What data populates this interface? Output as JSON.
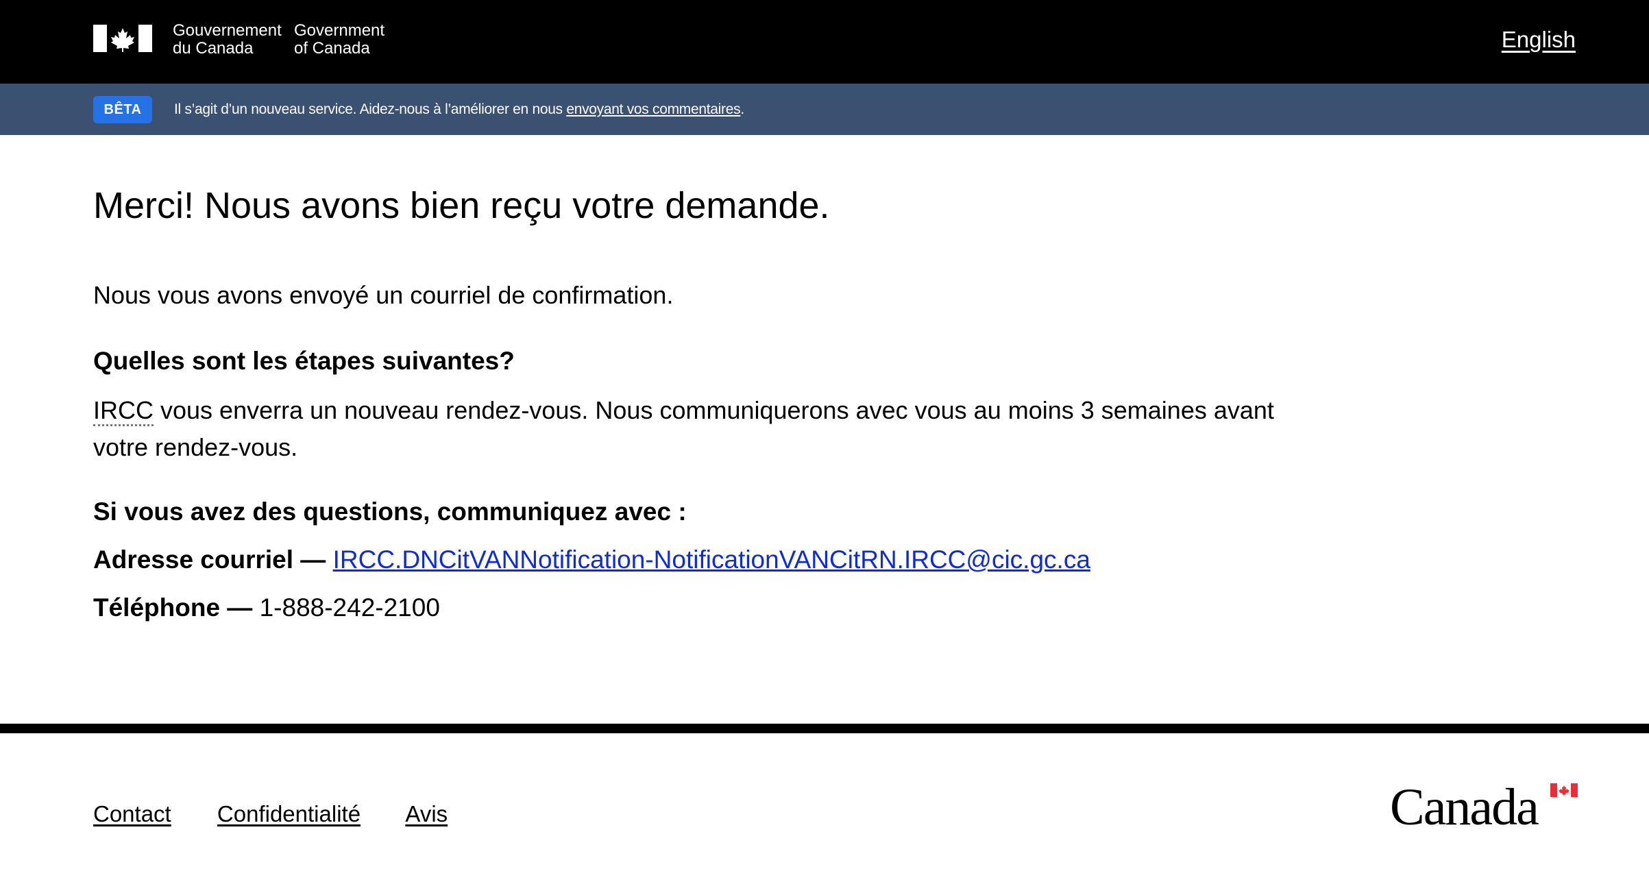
{
  "header": {
    "signature_fr_line1": "Gouvernement",
    "signature_fr_line2": "du Canada",
    "signature_en_line1": "Government",
    "signature_en_line2": "of Canada",
    "language_toggle": "English"
  },
  "beta_banner": {
    "badge": "BÊTA",
    "text": "Il s’agit d’un nouveau service. Aidez-nous à l’améliorer en nous ",
    "link": "envoyant vos commentaires",
    "text_end": "."
  },
  "main": {
    "title": "Merci! Nous avons bien reçu votre demande.",
    "confirmation": "Nous vous avons envoyé un courriel de confirmation.",
    "next_steps_heading": "Quelles sont les étapes suivantes?",
    "next_steps_abbr": "IRCC",
    "next_steps_body": " vous enverra un nouveau rendez-vous. Nous communiquerons avec vous au moins 3 semaines avant votre rendez-vous.",
    "questions_heading": "Si vous avez des questions, communiquez avec :",
    "email_label": "Adresse courriel —",
    "email_value": "IRCC.DNCitVANNotification-NotificationVANCitRN.IRCC@cic.gc.ca",
    "phone_label": "Téléphone —",
    "phone_value": "1-888-242-2100"
  },
  "footer": {
    "links": [
      "Contact",
      "Confidentialité",
      "Avis"
    ],
    "wordmark": "Canada"
  },
  "colors": {
    "header_bg": "#000000",
    "beta_banner_bg": "#3a5171",
    "beta_badge_bg": "#2572e6",
    "link": "#0e2bd6",
    "flag_red": "#eb2d37"
  },
  "icons": {
    "fip": "canada-flag-icon",
    "wordmark_flag": "canada-flag-icon"
  }
}
